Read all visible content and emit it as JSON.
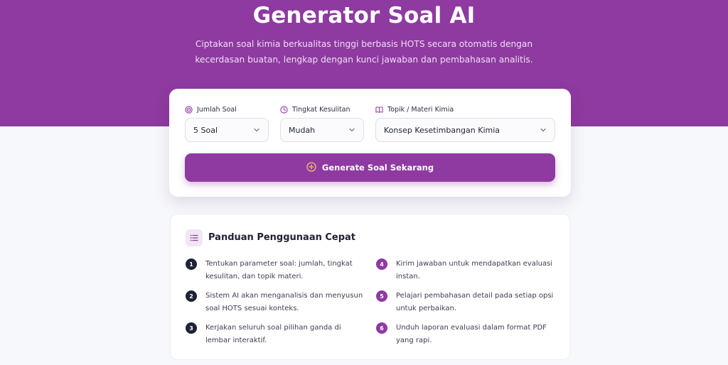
{
  "hero": {
    "title": "Generator Soal AI",
    "subtitle": "Ciptakan soal kimia berkualitas tinggi berbasis HOTS secara otomatis dengan kecerdasan buatan, lengkap dengan kunci jawaban dan pembahasan analitis."
  },
  "form": {
    "fields": [
      {
        "label": "Jumlah Soal",
        "icon": "target-icon",
        "value": "5 Soal"
      },
      {
        "label": "Tingkat Kesulitan",
        "icon": "clock-icon",
        "value": "Mudah"
      },
      {
        "label": "Topik / Materi Kimia",
        "icon": "book-icon",
        "value": "Konsep Kesetimbangan Kimia"
      }
    ],
    "generate_label": "Generate Soal Sekarang"
  },
  "guide": {
    "title": "Panduan Penggunaan Cepat",
    "steps": [
      {
        "num": "1",
        "text": "Tentukan parameter soal: jumlah, tingkat kesulitan, dan topik materi."
      },
      {
        "num": "2",
        "text": "Sistem AI akan menganalisis dan menyusun soal HOTS sesuai konteks."
      },
      {
        "num": "3",
        "text": "Kerjakan seluruh soal pilihan ganda di lembar interaktif."
      },
      {
        "num": "4",
        "text": "Kirim jawaban untuk mendapatkan evaluasi instan."
      },
      {
        "num": "5",
        "text": "Pelajari pembahasan detail pada setiap opsi untuk perbaikan."
      },
      {
        "num": "6",
        "text": "Unduh laporan evaluasi dalam format PDF yang rapi."
      }
    ]
  },
  "colors": {
    "brand": "#8e3aa0",
    "step_dark": "#1e2235",
    "background": "#f7f8fc"
  }
}
